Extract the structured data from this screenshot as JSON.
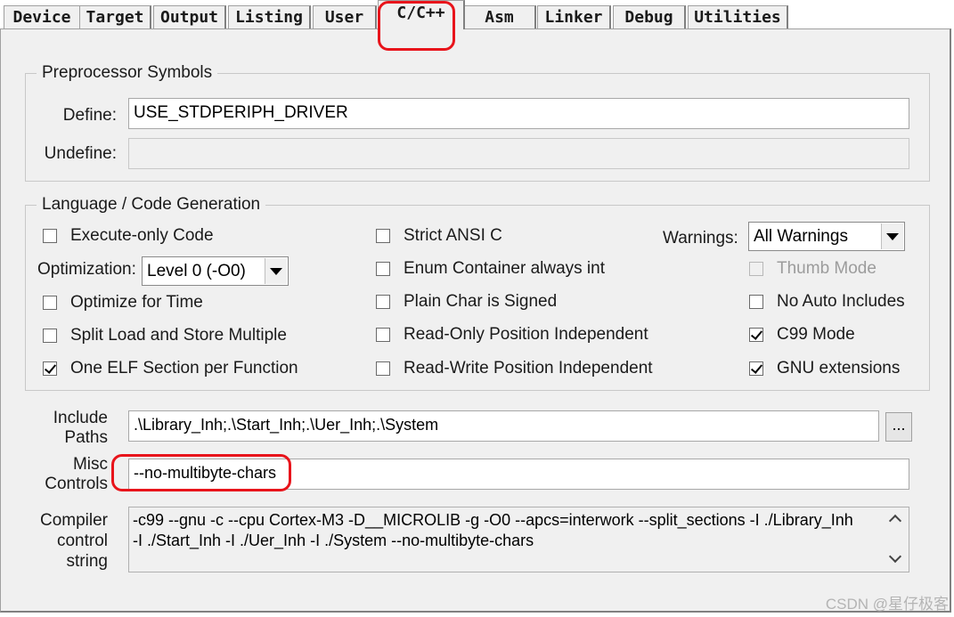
{
  "tabs": [
    {
      "label": "Device"
    },
    {
      "label": "Target"
    },
    {
      "label": "Output"
    },
    {
      "label": "Listing"
    },
    {
      "label": "User"
    },
    {
      "label": "C/C++",
      "active": true
    },
    {
      "label": "Asm"
    },
    {
      "label": "Linker"
    },
    {
      "label": "Debug"
    },
    {
      "label": "Utilities"
    }
  ],
  "preprocessor": {
    "title": "Preprocessor Symbols",
    "define_label": "Define:",
    "define_value": "USE_STDPERIPH_DRIVER",
    "undefine_label": "Undefine:",
    "undefine_value": ""
  },
  "language": {
    "title": "Language / Code Generation",
    "execute_only": {
      "label": "Execute-only Code",
      "checked": false
    },
    "optimization_label": "Optimization:",
    "optimization_value": "Level 0 (-O0)",
    "optimize_time": {
      "label": "Optimize for Time",
      "checked": false
    },
    "split_load": {
      "label": "Split Load and Store Multiple",
      "checked": false
    },
    "one_elf": {
      "label": "One ELF Section per Function",
      "checked": true
    },
    "strict_ansi": {
      "label": "Strict ANSI C",
      "checked": false
    },
    "enum_container": {
      "label": "Enum Container always int",
      "checked": false
    },
    "plain_char": {
      "label": "Plain Char is Signed",
      "checked": false
    },
    "ro_pi": {
      "label": "Read-Only Position Independent",
      "checked": false
    },
    "rw_pi": {
      "label": "Read-Write Position Independent",
      "checked": false
    },
    "warnings_label": "Warnings:",
    "warnings_value": "All Warnings",
    "thumb_mode": {
      "label": "Thumb Mode",
      "checked": false,
      "disabled": true
    },
    "no_auto_includes": {
      "label": "No Auto Includes",
      "checked": false
    },
    "c99_mode": {
      "label": "C99 Mode",
      "checked": true
    },
    "gnu_ext": {
      "label": "GNU extensions",
      "checked": true
    }
  },
  "include": {
    "label_1": "Include",
    "label_2": "Paths",
    "value": ".\\Library_Inh;.\\Start_Inh;.\\Uer_Inh;.\\System",
    "browse_label": "..."
  },
  "misc": {
    "label_1": "Misc",
    "label_2": "Controls",
    "value": "--no-multibyte-chars"
  },
  "compiler": {
    "label_1": "Compiler",
    "label_2": "control",
    "label_3": "string",
    "line_1": "-c99 --gnu -c --cpu Cortex-M3 -D__MICROLIB -g -O0 --apcs=interwork --split_sections -I ./Library_Inh",
    "line_2": "-I ./Start_Inh -I ./Uer_Inh -I ./System --no-multibyte-chars"
  },
  "watermark": "CSDN @星仔极客",
  "colors": {
    "highlight": "#e8141b",
    "panel": "#f0f0f0"
  }
}
